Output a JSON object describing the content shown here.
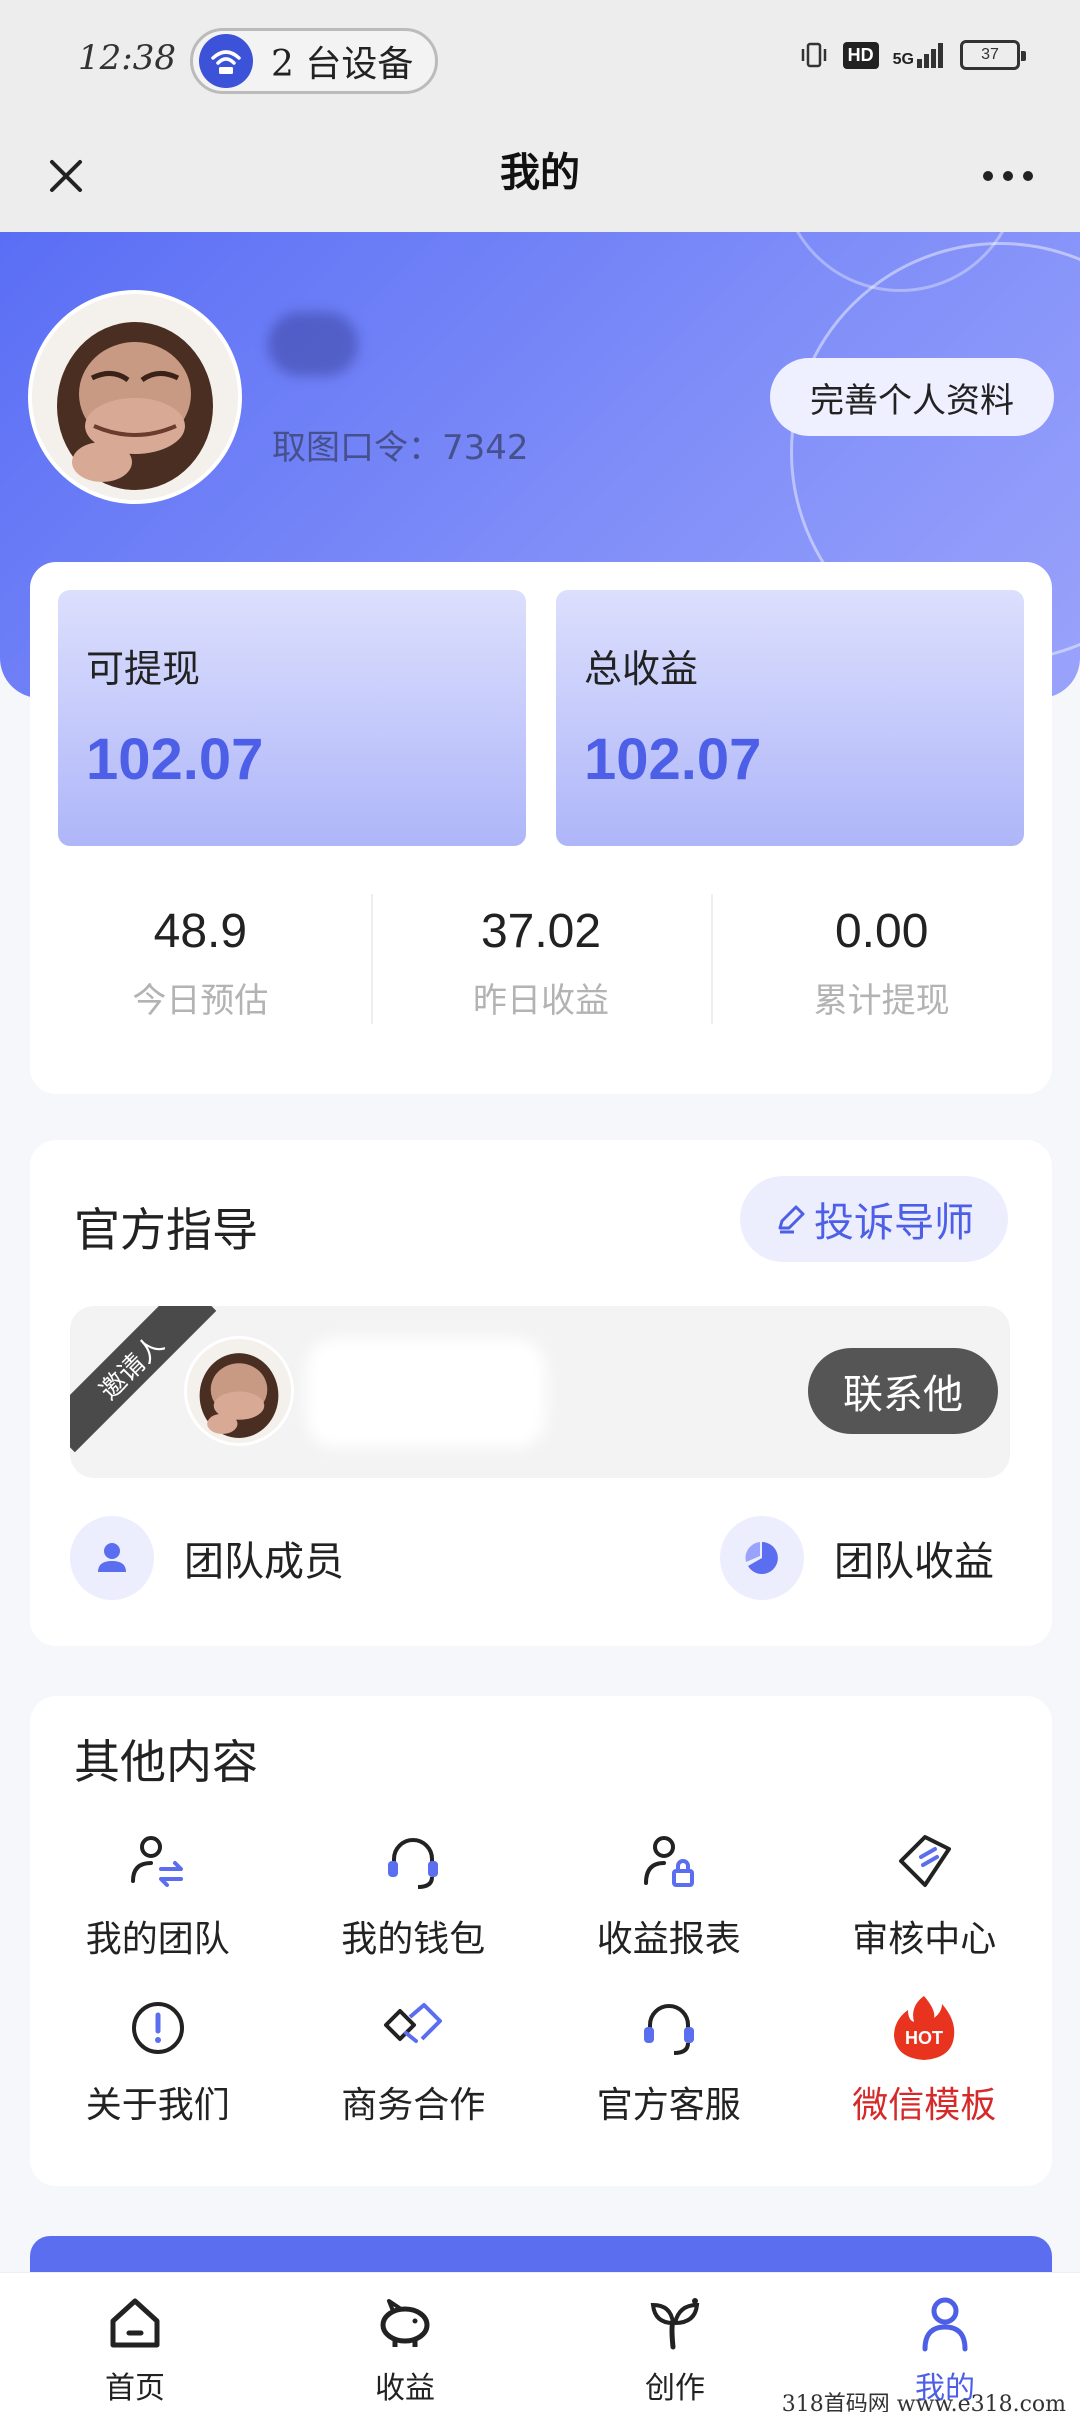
{
  "status_bar": {
    "time": "12:38",
    "devices_label": "2 台设备",
    "hd": "HD",
    "network": "5G",
    "battery": "37"
  },
  "header": {
    "title": "我的"
  },
  "profile": {
    "user_code": "取图口令：7342",
    "complete_profile_label": "完善个人资料"
  },
  "earnings": {
    "withdrawable_label": "可提现",
    "withdrawable_value": "102.07",
    "total_label": "总收益",
    "total_value": "102.07",
    "stats": [
      {
        "value": "48.9",
        "label": "今日预估"
      },
      {
        "value": "37.02",
        "label": "昨日收益"
      },
      {
        "value": "0.00",
        "label": "累计提现"
      }
    ]
  },
  "guide": {
    "title": "官方指导",
    "complain_label": "投诉导师",
    "inviter_ribbon": "邀请人",
    "contact_label": "联系他",
    "team_members_label": "团队成员",
    "team_earnings_label": "团队收益"
  },
  "other": {
    "title": "其他内容",
    "items": [
      {
        "label": "我的团队",
        "icon": "team-swap-icon"
      },
      {
        "label": "我的钱包",
        "icon": "headset-icon"
      },
      {
        "label": "收益报表",
        "icon": "user-lock-icon"
      },
      {
        "label": "审核中心",
        "icon": "tag-icon"
      },
      {
        "label": "关于我们",
        "icon": "info-icon"
      },
      {
        "label": "商务合作",
        "icon": "handshake-icon"
      },
      {
        "label": "官方客服",
        "icon": "headset-icon"
      },
      {
        "label": "微信模板",
        "icon": "hot-flame-icon",
        "badge": "HOT"
      }
    ]
  },
  "tabbar": {
    "tabs": [
      {
        "label": "首页",
        "icon": "home-icon"
      },
      {
        "label": "收益",
        "icon": "piggy-bank-icon"
      },
      {
        "label": "创作",
        "icon": "sprout-icon"
      },
      {
        "label": "我的",
        "icon": "user-icon"
      }
    ]
  },
  "watermark": "318首码网  www.e318.com",
  "colors": {
    "accent": "#4d5fe6",
    "hero_gradient_start": "#5a6ef5",
    "hot_red": "#d62a2a"
  }
}
